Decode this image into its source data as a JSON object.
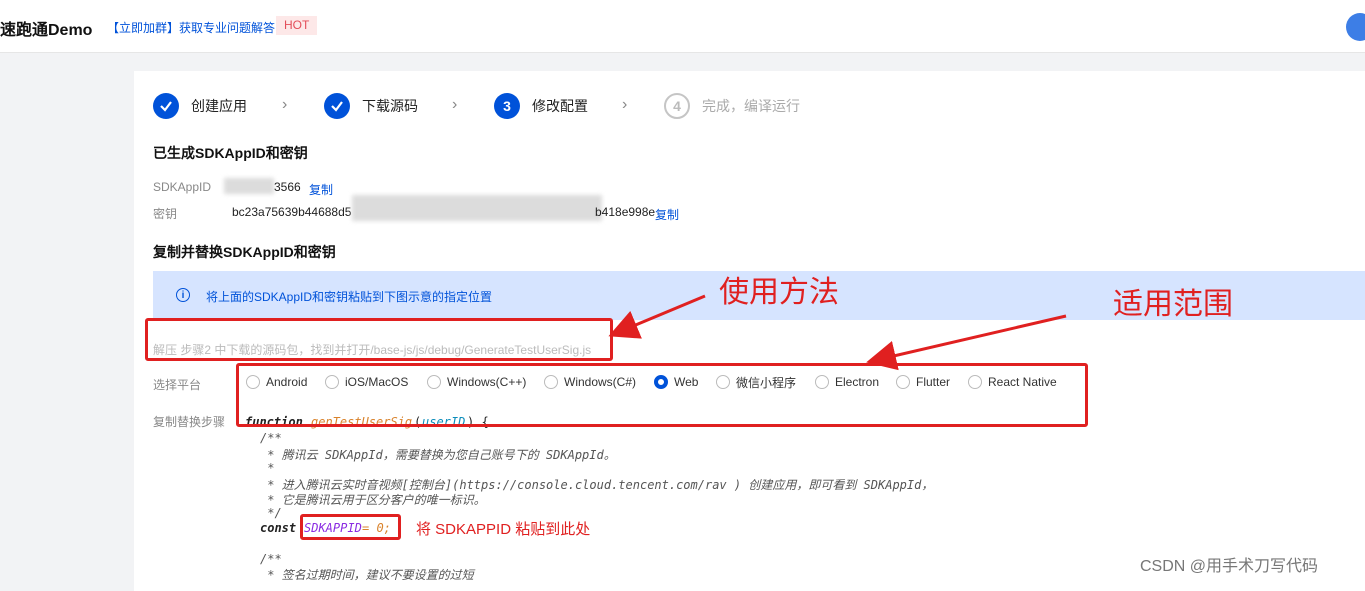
{
  "header": {
    "app_title": "速跑通Demo",
    "promo_link": "【立即加群】获取专业问题解答",
    "hot_badge": "HOT"
  },
  "steps": [
    {
      "number": "✓",
      "label": "创建应用",
      "state": "done"
    },
    {
      "number": "✓",
      "label": "下载源码",
      "state": "done"
    },
    {
      "number": "3",
      "label": "修改配置",
      "state": "active"
    },
    {
      "number": "4",
      "label": "完成，编译运行",
      "state": "todo"
    }
  ],
  "generated_section": {
    "title": "已生成SDKAppID和密钥",
    "sdkappid_label": "SDKAppID",
    "sdkappid_value": "3566",
    "key_label": "密钥",
    "key_value_start": "bc23a75639b44688d5",
    "key_value_end": "b418e998e",
    "copy_label": "复制"
  },
  "replace_section": {
    "title": "复制并替换SDKAppID和密钥",
    "info_text": "将上面的SDKAppID和密钥粘贴到下图示意的指定位置",
    "hint_text": "解压 步骤2 中下载的源码包，找到并打开/base-js/js/debug/GenerateTestUserSig.js",
    "platform_label": "选择平台",
    "copy_replace_label": "复制替换步骤",
    "platforms": [
      {
        "label": "Android",
        "checked": false
      },
      {
        "label": "iOS/MacOS",
        "checked": false
      },
      {
        "label": "Windows(C++)",
        "checked": false
      },
      {
        "label": "Windows(C#)",
        "checked": false
      },
      {
        "label": "Web",
        "checked": true
      },
      {
        "label": "微信小程序",
        "checked": false
      },
      {
        "label": "Electron",
        "checked": false
      },
      {
        "label": "Flutter",
        "checked": false
      },
      {
        "label": "React Native",
        "checked": false
      }
    ]
  },
  "code": {
    "kw_function": "function",
    "fn_name": "genTestUserSig",
    "open_paren": "(",
    "param": "userID",
    "close_brace": ") {",
    "c1": "/**",
    "c2": " * 腾讯云 SDKAppId，需要替换为您自己账号下的 SDKAppId。",
    "c3": " *",
    "c4": " * 进入腾讯云实时音视频[控制台](https://console.cloud.tencent.com/rav ) 创建应用，即可看到 SDKAppId，",
    "c5": " * 它是腾讯云用于区分客户的唯一标识。",
    "c6": " */",
    "kw_const": "const",
    "var_name": "SDKAPPID",
    "assign": " = 0;",
    "c7": "/**",
    "c8": " * 签名过期时间，建议不要设置的过短"
  },
  "annotations": {
    "usage": "使用方法",
    "scope": "适用范围",
    "paste_here": "将 SDKAPPID 粘贴到此处"
  },
  "watermark": "CSDN @用手术刀写代码",
  "colors": {
    "primary": "#0052d9",
    "annotation_red": "#e02020",
    "info_bg": "#d6e4ff"
  }
}
